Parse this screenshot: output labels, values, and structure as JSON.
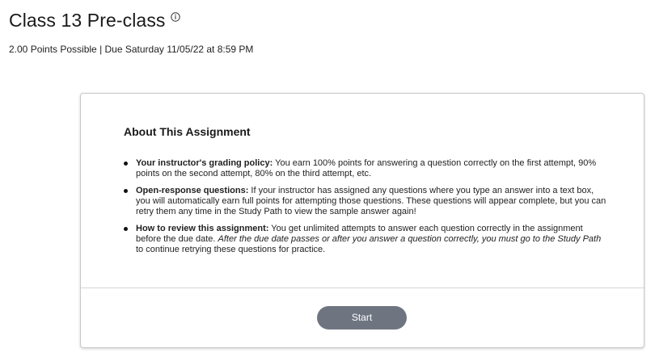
{
  "header": {
    "title": "Class 13 Pre-class",
    "info_icon": "info-circle-icon",
    "meta": "2.00 Points Possible | Due Saturday 11/05/22 at 8:59 PM"
  },
  "card": {
    "heading": "About This Assignment",
    "bullets": [
      {
        "label": "Your instructor's grading policy:",
        "text": " You earn 100% points for answering a question correctly on the first attempt, 90% points on the second attempt, 80% on the third attempt, etc."
      },
      {
        "label": "Open-response questions:",
        "text": " If your instructor has assigned any questions where you type an answer into a text box, you will automatically earn full points for attempting those questions. These questions will appear complete, but you can retry them any time in the Study Path to view the sample answer again!"
      },
      {
        "label": "How to review this assignment:",
        "text": " You get unlimited attempts to answer each question correctly in the assignment before the due date. ",
        "italic": "After the due date passes or after you answer a question correctly, you must go to the Study Path",
        "text_after": " to continue retrying these questions for practice."
      }
    ],
    "start_label": "Start"
  },
  "colors": {
    "button_bg": "#6f7580",
    "button_text": "#ffffff",
    "card_border": "#c9c9c9",
    "divider": "#d4d4d4"
  }
}
